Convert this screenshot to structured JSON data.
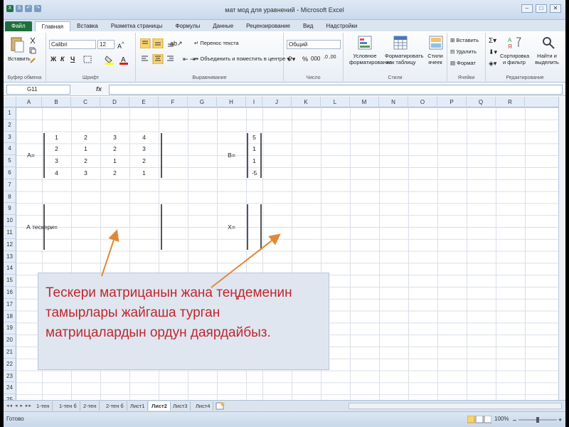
{
  "window": {
    "title": "мат мод для уравнений - Microsoft Excel",
    "qat": [
      "X",
      "S",
      "↶",
      "↷"
    ],
    "buttons": [
      "–",
      "□",
      "✕"
    ]
  },
  "ribbon_tabs": [
    "Файл",
    "Главная",
    "Вставка",
    "Разметка страницы",
    "Формулы",
    "Данные",
    "Рецензирование",
    "Вид",
    "Надстройки"
  ],
  "ribbon": {
    "clipboard": {
      "paste": "Вставить",
      "label": "Буфер обмена"
    },
    "font": {
      "name": "Calibri",
      "size": "12",
      "bold": "Ж",
      "italic": "К",
      "underline": "Ч",
      "label": "Шрифт"
    },
    "alignment": {
      "wrap": "Перенос текста",
      "merge": "Объединить и поместить в центре",
      "label": "Выравнивание"
    },
    "number": {
      "format": "Общий",
      "percent": "%",
      "thousands": "000",
      "label": "Число"
    },
    "styles": {
      "conditional_1": "Условное",
      "conditional_2": "форматирование",
      "table_1": "Форматировать",
      "table_2": "как таблицу",
      "cell_1": "Стили",
      "cell_2": "ячеек",
      "label": "Стили"
    },
    "cells": {
      "insert": "Вставить",
      "delete": "Удалить",
      "format": "Формат",
      "label": "Ячейки"
    },
    "editing": {
      "sort_1": "Сортировка",
      "sort_2": "и фильтр",
      "find_1": "Найти и",
      "find_2": "выделить",
      "label": "Редактирование"
    }
  },
  "formula_bar": {
    "name_box": "G11",
    "fx": "fx",
    "value": ""
  },
  "columns": [
    "A",
    "B",
    "C",
    "D",
    "E",
    "F",
    "G",
    "H",
    "I",
    "J",
    "K",
    "L",
    "M",
    "N",
    "O",
    "P",
    "Q",
    "R"
  ],
  "rows": [
    "1",
    "2",
    "3",
    "4",
    "5",
    "6",
    "7",
    "8",
    "9",
    "10",
    "11",
    "12",
    "13",
    "14",
    "15",
    "16",
    "17",
    "18",
    "19",
    "20",
    "21",
    "22",
    "23",
    "24",
    "25"
  ],
  "labels": {
    "a": "A=",
    "b": "B=",
    "a_inverse": "А тескери=",
    "x": "X="
  },
  "matrix_a": [
    [
      "1",
      "2",
      "3",
      "4"
    ],
    [
      "2",
      "1",
      "2",
      "3"
    ],
    [
      "3",
      "2",
      "1",
      "2"
    ],
    [
      "4",
      "3",
      "2",
      "1"
    ]
  ],
  "vector_b": [
    "5",
    "1",
    "1",
    "-5"
  ],
  "note": {
    "lines": [
      "Тескери матрицанын жана теңдеменин",
      "тамырлары жайгаша турган",
      "матрицалардын ордун даярдайбыз."
    ]
  },
  "sheet_tabs": [
    "1-тен",
    "1-тен б",
    "2-тен",
    "2-тен б",
    "Лист1",
    "Лист2",
    "Лист3",
    "Лист4"
  ],
  "active_sheet": "Лист2",
  "status": {
    "ready": "Готово",
    "zoom": "100%"
  }
}
